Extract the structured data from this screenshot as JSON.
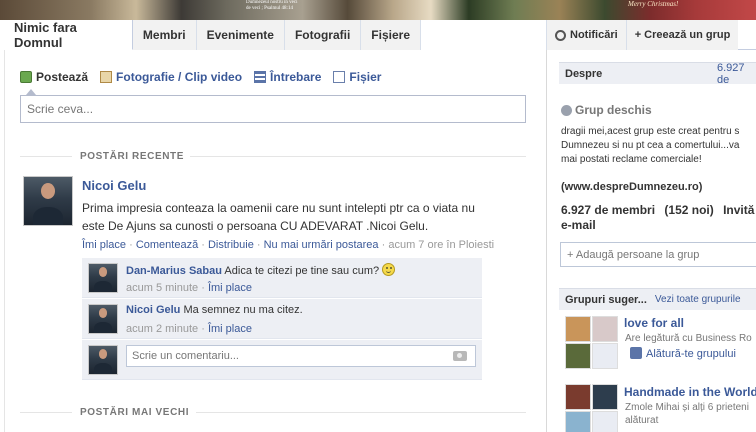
{
  "banner": {
    "text_line1": "Dumnezeul nostru in veci",
    "text_line2": "de veci ;    Psalmul 48:14",
    "xmas": "Merry Christmas!"
  },
  "tabs": {
    "group_name": "Nimic fara Domnul",
    "items": [
      "Membri",
      "Evenimente",
      "Fotografii",
      "Fișiere"
    ]
  },
  "topbar_right": {
    "notifications": "Notificări",
    "create_group": "+ Creează un grup"
  },
  "composer": {
    "links": [
      "Postează",
      "Fotografie / Clip video",
      "Întrebare",
      "Fișier"
    ],
    "placeholder": "Scrie ceva..."
  },
  "feed": {
    "recent_heading": "POSTĂRI RECENTE",
    "older_heading": "POSTĂRI MAI VECHI",
    "post": {
      "author": "Nicoi Gelu",
      "text_line1": "Prima impresia conteaza la oamenii care nu sunt intelepti ptr ca o viata nu",
      "text_line2": "este De Ajuns sa cunosti o persoana CU ADEVARAT .Nicoi Gelu.",
      "actions": [
        "Îmi place",
        "Comentează",
        "Distribuie",
        "Nu mai urmări postarea"
      ],
      "time": "acum 7 ore în Ploiesti"
    },
    "comments": [
      {
        "author": "Dan-Marius Sabau",
        "text": "Adica te citezi pe tine sau cum?",
        "time": "acum 5 minute",
        "like": "Îmi place"
      },
      {
        "author": "Nicoi Gelu",
        "text": "Ma semnez nu ma citez.",
        "time": "acum 2 minute",
        "like": "Îmi place"
      }
    ],
    "comment_placeholder": "Scrie un comentariu..."
  },
  "sidebar": {
    "about_label": "Despre",
    "about_count": "6.927 de",
    "group_type": "Grup deschis",
    "description_lines": [
      "dragii mei,acest grup este creat pentru s",
      "Dumnezeu si nu pt cea a comertului...va",
      "mai postati reclame comerciale!"
    ],
    "website": "(www.despreDumnezeu.ro)",
    "members": "6.927 de membri",
    "new_members": "(152 noi)",
    "invite": "Invită",
    "email": "e-mail",
    "add_people_placeholder": "+ Adaugă persoane la grup",
    "suggestions_label": "Grupuri suger...",
    "see_all": "Vezi toate grupurile",
    "suggested": [
      {
        "name": "love for all",
        "desc": "Are legătură cu Business Ro",
        "join": "Alătură-te grupului"
      },
      {
        "name": "Handmade in the World",
        "desc": "Zmole Mihai și alți 6 prieteni",
        "join": "alăturat"
      }
    ]
  }
}
